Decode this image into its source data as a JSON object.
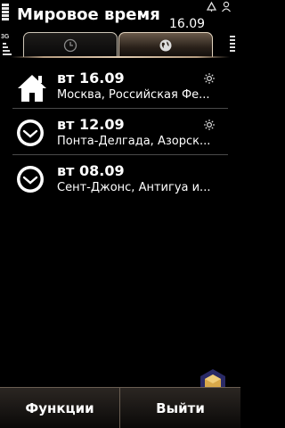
{
  "header": {
    "title": "Мировое время",
    "time": "16.09",
    "network_label": "3G"
  },
  "tabs": [
    {
      "icon": "clock-icon",
      "selected": false
    },
    {
      "icon": "globe-icon",
      "selected": true
    }
  ],
  "cities": [
    {
      "date": "вт 16.09",
      "place": "Москва, Российская Фе...",
      "icon": "home-icon",
      "sun": true
    },
    {
      "date": "вт 12.09",
      "place": "Понта-Делгада, Азорск...",
      "icon": "clock-icon",
      "sun": true
    },
    {
      "date": "вт 08.09",
      "place": "Сент-Джонс, Антигуа и...",
      "icon": "clock-icon",
      "sun": false
    }
  ],
  "softkeys": {
    "left": "Функции",
    "right": "Выйти"
  },
  "colors": {
    "accent": "#cfb89a",
    "background": "#000000"
  }
}
